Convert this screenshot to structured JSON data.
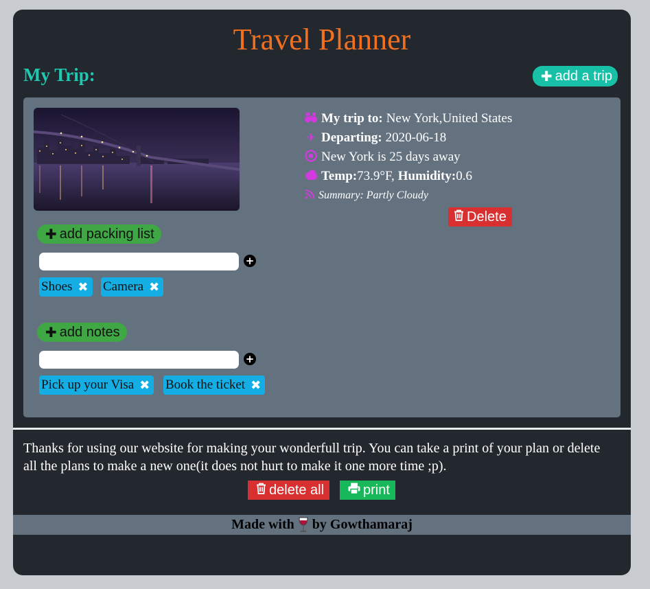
{
  "app": {
    "title": "Travel Planner"
  },
  "section": {
    "title": "My Trip:"
  },
  "buttons": {
    "add_trip": "add a trip",
    "add_packing": "add packing list",
    "add_notes": "add notes",
    "delete": "Delete",
    "delete_all": "delete all",
    "print": "print"
  },
  "packing": {
    "input_value": "",
    "items": [
      "Shoes",
      "Camera"
    ]
  },
  "notes": {
    "input_value": "",
    "items": [
      "Pick up your Visa",
      "Book the ticket"
    ]
  },
  "trip": {
    "dest_label": "My trip to:",
    "dest_value": "New York,United States",
    "depart_label": "Departing:",
    "depart_value": "2020-06-18",
    "countdown": "New York is 25 days away",
    "temp_label": "Temp:",
    "temp_value": "73.9°F,",
    "humidity_label": "Humidity:",
    "humidity_value": "0.6",
    "summary": "Summary: Partly Cloudy"
  },
  "thanks": "Thanks for using our website for making your wonderfull trip. You can take a print of your plan or delete all the plans to make a new one(it does not hurt to make it one more time ;p).",
  "footer": {
    "made_with": "Made with",
    "by": "by Gowthamaraj"
  },
  "icons": {
    "plus": "plus-icon",
    "binoculars": "binoculars-icon",
    "plane": "plane-icon",
    "target": "target-icon",
    "cloud": "cloud-icon",
    "rss": "rss-icon",
    "trash": "trash-icon",
    "print": "printer-icon",
    "close": "close-icon",
    "wine": "wine-glass-icon"
  },
  "colors": {
    "title": "#f07020",
    "section_title": "#1fc8b0",
    "add_trip": "#17c0a6",
    "green_pill": "#3fa845",
    "tag": "#15aee4",
    "danger": "#d83030",
    "print": "#17b85a",
    "icon_accent": "#d23ae0",
    "card": "#647280",
    "panel": "#23272e"
  }
}
